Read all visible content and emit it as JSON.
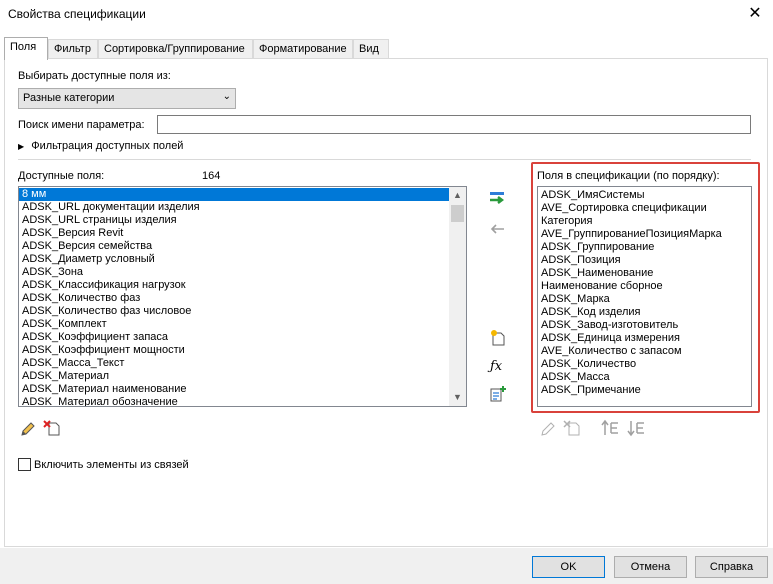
{
  "window": {
    "title": "Свойства спецификации",
    "close_glyph": "✕"
  },
  "tabs": [
    {
      "label": "Поля",
      "active": true
    },
    {
      "label": "Фильтр",
      "active": false
    },
    {
      "label": "Сортировка/Группирование",
      "active": false
    },
    {
      "label": "Форматирование",
      "active": false
    },
    {
      "label": "Вид",
      "active": false
    }
  ],
  "fields_tab": {
    "select_from_label": "Выбирать доступные поля из:",
    "category_combo_value": "Разные категории",
    "search_label": "Поиск имени параметра:",
    "search_value": "",
    "filter_section_label": "Фильтрация доступных полей",
    "available_label": "Доступные поля:",
    "available_count": "164",
    "available_fields": [
      "8 мм",
      "ADSK_URL документации изделия",
      "ADSK_URL страницы изделия",
      "ADSK_Версия Revit",
      "ADSK_Версия семейства",
      "ADSK_Диаметр условный",
      "ADSK_Зона",
      "ADSK_Классификация нагрузок",
      "ADSK_Количество фаз",
      "ADSK_Количество фаз числовое",
      "ADSK_Комплект",
      "ADSK_Коэффициент запаса",
      "ADSK_Коэффициент мощности",
      "ADSK_Масса_Текст",
      "ADSK_Материал",
      "ADSK_Материал наименование",
      "ADSK_Материал обозначение"
    ],
    "selected_available_index": 0,
    "schedule_label": "Поля в спецификации (по порядку):",
    "schedule_fields": [
      "ADSK_ИмяСистемы",
      "AVE_Сортировка спецификации",
      "Категория",
      "AVE_ГруппированиеПозицияМарка",
      "ADSK_Группирование",
      "ADSK_Позиция",
      "ADSK_Наименование",
      "Наименование сборное",
      "ADSK_Марка",
      "ADSK_Код изделия",
      "ADSK_Завод-изготовитель",
      "ADSK_Единица измерения",
      "AVE_Количество с запасом",
      "ADSK_Количество",
      "ADSK_Масса",
      "ADSK_Примечание"
    ],
    "include_links_label": "Включить элементы из связей",
    "include_links_checked": false,
    "highlight_color": "#d9423b"
  },
  "buttons": {
    "ok": "OK",
    "cancel": "Отмена",
    "help": "Справка"
  }
}
